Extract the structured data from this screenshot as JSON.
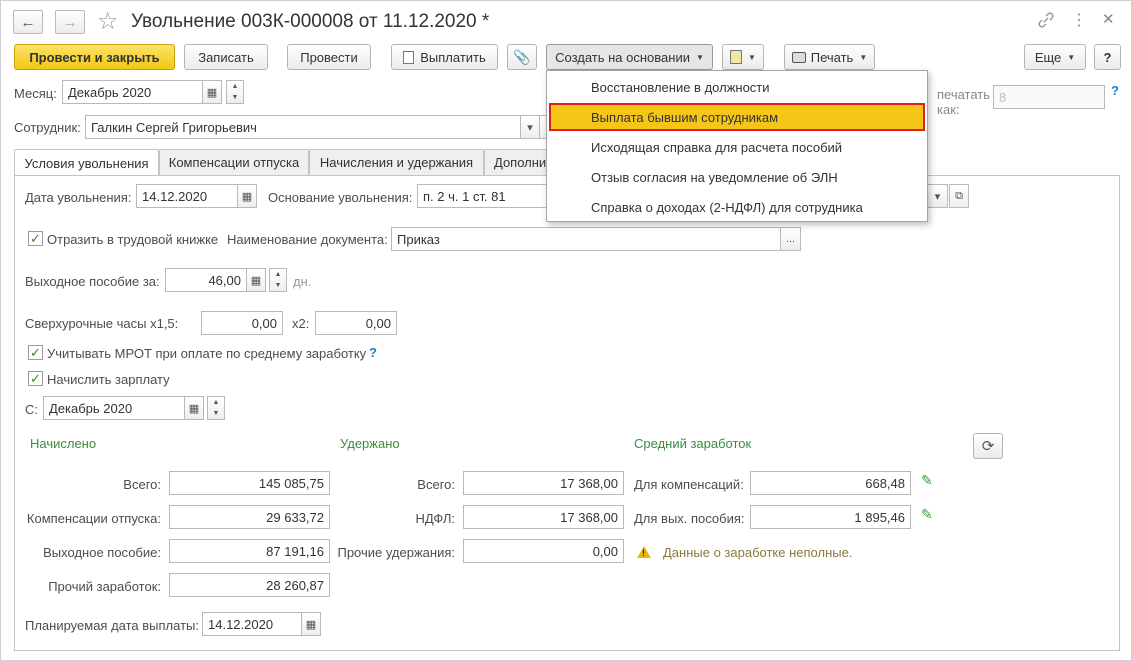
{
  "window": {
    "title": "Увольнение 003К-000008 от 11.12.2020 *",
    "back_icon": "←",
    "forward_icon": "→",
    "star_icon": "☆",
    "link_icon": "🔗",
    "more_icon": "⋮",
    "restore_icon": "▢",
    "close_icon": "✕"
  },
  "toolbar": {
    "post_close": "Провести и закрыть",
    "save": "Записать",
    "post": "Провести",
    "pay": "Выплатить",
    "create_based": "Создать на основании",
    "print": "Печать",
    "more": "Еще",
    "help": "?"
  },
  "header": {
    "month_label": "Месяц:",
    "month_value": "Декабрь 2020",
    "employee_label": "Сотрудник:",
    "employee_value": "Галкин Сергей Григорьевич",
    "print_as_label_1": "печатать",
    "print_as_label_2": "как:",
    "print_as_value": "8",
    "print_as_help": "?"
  },
  "dropdown_menu": {
    "items": [
      "Восстановление в должности",
      "Выплата бывшим сотрудникам",
      "Исходящая справка для расчета пособий",
      "Отзыв согласия на уведомление об ЭЛН",
      "Справка о доходах (2-НДФЛ) для сотрудника"
    ],
    "highlighted_index": 1
  },
  "tabs": [
    {
      "label": "Условия увольнения",
      "active": true
    },
    {
      "label": "Компенсации отпуска",
      "active": false
    },
    {
      "label": "Начисления и удержания",
      "active": false
    },
    {
      "label": "Дополнит",
      "active": false
    }
  ],
  "form": {
    "dismissal_date_label": "Дата увольнения:",
    "dismissal_date_value": "14.12.2020",
    "basis_label": "Основание увольнения:",
    "basis_value": "п. 2 ч. 1 ст. 81",
    "workbook_label": "Отразить в трудовой книжке",
    "workbook_checked": true,
    "doc_name_label": "Наименование документа:",
    "doc_name_value": "Приказ",
    "severance_label": "Выходное пособие за:",
    "severance_value": "46,00",
    "severance_unit": "дн.",
    "overtime_label": "Сверхурочные часы х1,5:",
    "overtime_x15_value": "0,00",
    "overtime_x2_label": "х2:",
    "overtime_x2_value": "0,00",
    "mrot_label": "Учитывать МРОТ при оплате по среднему заработку",
    "mrot_checked": true,
    "mrot_help": "?",
    "salary_label": "Начислить зарплату",
    "salary_checked": true,
    "from_label": "С:",
    "from_value": "Декабрь 2020",
    "planned_date_label": "Планируемая дата выплаты:",
    "planned_date_value": "14.12.2020"
  },
  "accrued": {
    "title": "Начислено",
    "rows": [
      {
        "label": "Всего:",
        "value": "145 085,75"
      },
      {
        "label": "Компенсации отпуска:",
        "value": "29 633,72"
      },
      {
        "label": "Выходное пособие:",
        "value": "87 191,16"
      },
      {
        "label": "Прочий заработок:",
        "value": "28 260,87"
      }
    ]
  },
  "withheld": {
    "title": "Удержано",
    "rows": [
      {
        "label": "Всего:",
        "value": "17 368,00"
      },
      {
        "label": "НДФЛ:",
        "value": "17 368,00"
      },
      {
        "label": "Прочие удержания:",
        "value": "0,00"
      }
    ]
  },
  "average": {
    "title": "Средний заработок",
    "rows": [
      {
        "label": "Для компенсаций:",
        "value": "668,48"
      },
      {
        "label": "Для вых. пособия:",
        "value": "1 895,46"
      }
    ],
    "warning": "Данные о заработке неполные.",
    "refresh_icon": "⟳"
  }
}
